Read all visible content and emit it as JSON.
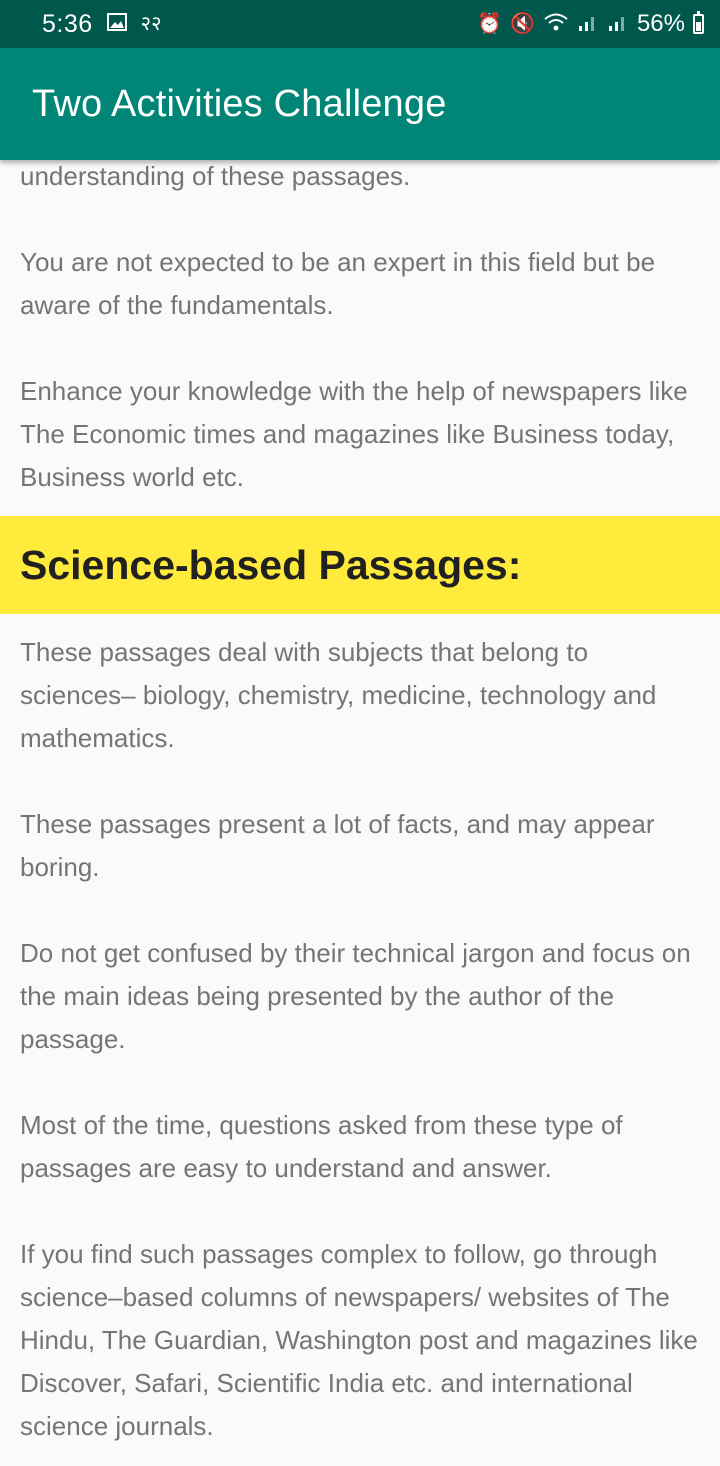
{
  "status_bar": {
    "time": "5:36",
    "extra": "२२",
    "battery": "56%",
    "battery_level": 0.56,
    "icons": [
      "image-icon",
      "alarm-icon",
      "mute-icon",
      "wifi-icon",
      "signal-icon",
      "signal-icon",
      "battery-icon"
    ]
  },
  "app_bar": {
    "title": "Two Activities Challenge"
  },
  "content": {
    "intro_paragraphs": [
      "understanding of these passages.",
      " You are not expected to be an expert in this field but be aware of the fundamentals.",
      " Enhance your knowledge with the help of newspapers like The Economic times and magazines like Business today, Business world etc."
    ],
    "section_title": "Science-based Passages:",
    "section_paragraphs": [
      "These passages deal with subjects that belong to sciences– biology, chemistry, medicine, technology and mathematics.",
      " These passages present a lot of facts, and may appear boring.",
      " Do not get confused by their technical jargon and focus on the main ideas being presented by the author of the passage.",
      " Most of the time, questions asked from these type of passages are easy to understand and answer.",
      " If you find such passages complex to follow, go through science–based columns of newspapers/ websites of The Hindu, The Guardian, Washington post and magazines like Discover, Safari, Scientific India etc. and international science journals."
    ]
  },
  "colors": {
    "status_bar": "#00574b",
    "app_bar": "#008577",
    "section_header": "#ffeb3b",
    "body_text": "#757575"
  }
}
